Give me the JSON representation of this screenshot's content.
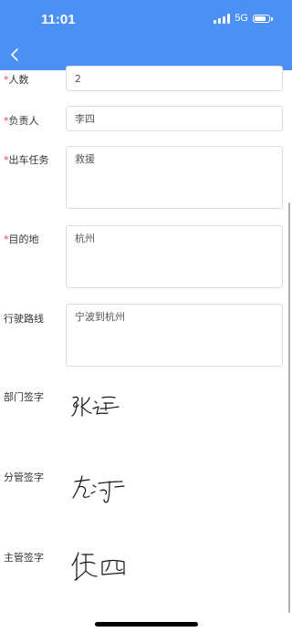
{
  "status_bar": {
    "time": "11:01",
    "network": "5G",
    "battery_level": 0.85
  },
  "nav": {
    "back_icon": "chevron-left-icon"
  },
  "form": {
    "people_count": {
      "required_mark": "*",
      "label": "人数",
      "value": "2"
    },
    "person_in_charge": {
      "required_mark": "*",
      "label": "负责人",
      "value": "李四"
    },
    "mission": {
      "required_mark": "*",
      "label": "出车任务",
      "value": "救援"
    },
    "destination": {
      "required_mark": "*",
      "label": "目的地",
      "value": "杭州"
    },
    "route": {
      "label": "行驶路线",
      "value": "宁波到杭州"
    },
    "dept_signature": {
      "label": "部门签字"
    },
    "branch_signature": {
      "label": "分管签字"
    },
    "supervisor_signature": {
      "label": "主管签字"
    }
  },
  "colors": {
    "header": "#4a90f5",
    "required": "#e64340",
    "border": "#dcdcdc"
  }
}
